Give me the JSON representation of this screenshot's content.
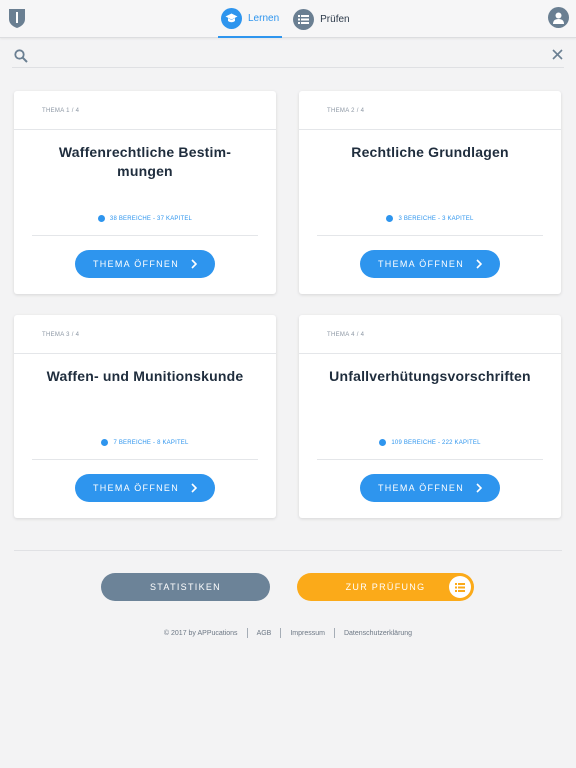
{
  "header": {
    "nav": [
      {
        "label": "Lernen",
        "icon": "graduation-cap-icon",
        "active": true
      },
      {
        "label": "Prüfen",
        "icon": "list-icon",
        "active": false
      }
    ],
    "user_icon": "user-icon",
    "logo_icon": "shield-logo-icon"
  },
  "search": {
    "value": "",
    "placeholder": ""
  },
  "cards": [
    {
      "label": "THEMA 1 / 4",
      "title": "Waffenrechtliche Bestim-mungen",
      "meta": "38 BEREICHE - 37 KAPITEL",
      "button": "THEMA ÖFFNEN"
    },
    {
      "label": "THEMA 2 / 4",
      "title": "Rechtliche Grundlagen",
      "meta": "3 BEREICHE - 3 KAPITEL",
      "button": "THEMA ÖFFNEN"
    },
    {
      "label": "THEMA 3 / 4",
      "title": "Waffen- und Munitionskunde",
      "meta": "7 BEREICHE - 8 KAPITEL",
      "button": "THEMA ÖFFNEN"
    },
    {
      "label": "THEMA 4 / 4",
      "title": "Unfallverhütungsvorschriften",
      "meta": "109 BEREICHE - 222 KAPITEL",
      "button": "THEMA ÖFFNEN"
    }
  ],
  "actions": {
    "statistics": "STATISTIKEN",
    "exam": "ZUR PRÜFUNG"
  },
  "footer": {
    "copyright": "© 2017 by APPucations",
    "links": [
      "AGB",
      "Impressum",
      "Datenschutzerklärung"
    ]
  },
  "colors": {
    "accent": "#2e95ee",
    "secondary": "#6c8398",
    "exam": "#fbaa19",
    "title": "#1f2d3d"
  }
}
